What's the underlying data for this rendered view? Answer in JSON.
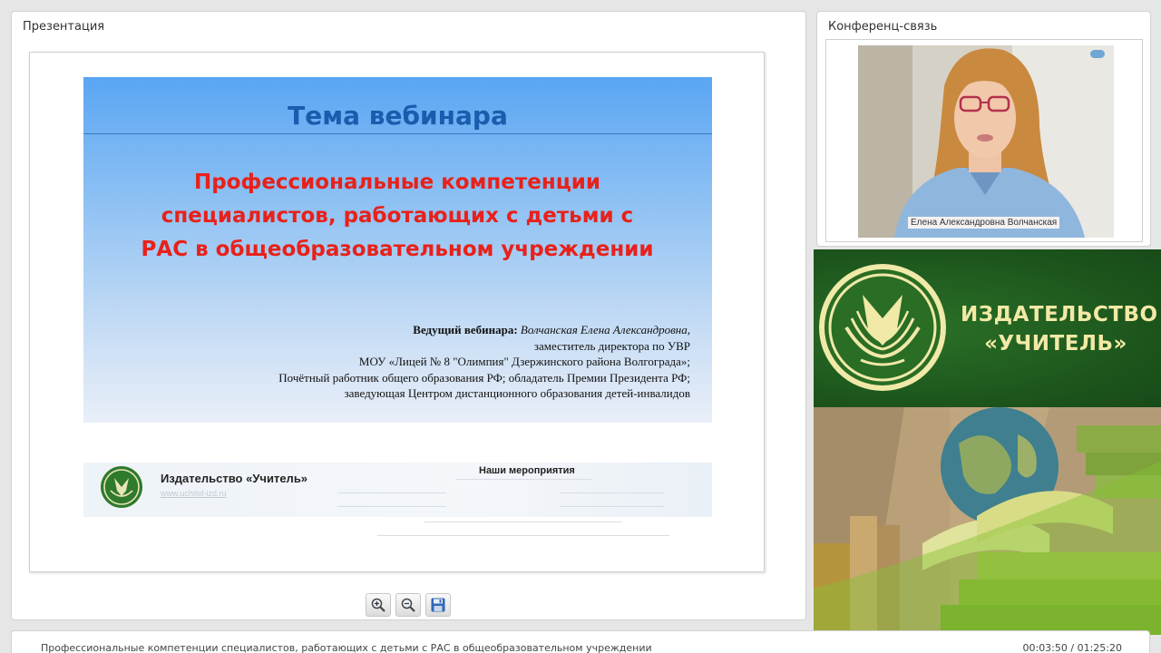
{
  "presentation": {
    "panel_title": "Презентация",
    "slide": {
      "heading": "Тема вебинара",
      "topic": "Профессиональные компетенции специалистов, работающих с детьми с РАС в общеобразовательном учреждении",
      "host_label": "Ведущий вебинара:",
      "host_name": "Волчанская Елена Александровна,",
      "host_line2": "заместитель директора по УВР",
      "host_line3": "МОУ «Лицей № 8 \"Олимпия\" Дзержинского района Волгограда»;",
      "host_line4": "Почётный работник общего образования РФ; обладатель Премии Президента РФ;",
      "host_line5": "заведующая Центром дистанционного образования детей-инвалидов",
      "publisher_name": "Издательство «Учитель»",
      "publisher_url": "www.uchitel-izd.ru",
      "events_title": "Наши мероприятия"
    },
    "toolbar": {
      "zoom_in_icon": "zoom-in-icon",
      "zoom_out_icon": "zoom-out-icon",
      "save_icon": "floppy-disk-icon"
    }
  },
  "conference": {
    "panel_title": "Конференц-связь",
    "participant_name": "Елена Александровна Волчанская"
  },
  "banner": {
    "line1": "ИЗДАТЕЛЬСТВО",
    "line2": "«УЧИТЕЛЬ»"
  },
  "footer": {
    "title": "Профессиональные компетенции специалистов, работающих с детьми с РАС в общеобразовательном учреждении",
    "time": "00:03:50 / 01:25:20"
  },
  "colors": {
    "slide_heading": "#1a5cae",
    "slide_topic": "#e8211a",
    "banner_green": "#1e5a1e",
    "banner_text": "#f3e9a6"
  }
}
